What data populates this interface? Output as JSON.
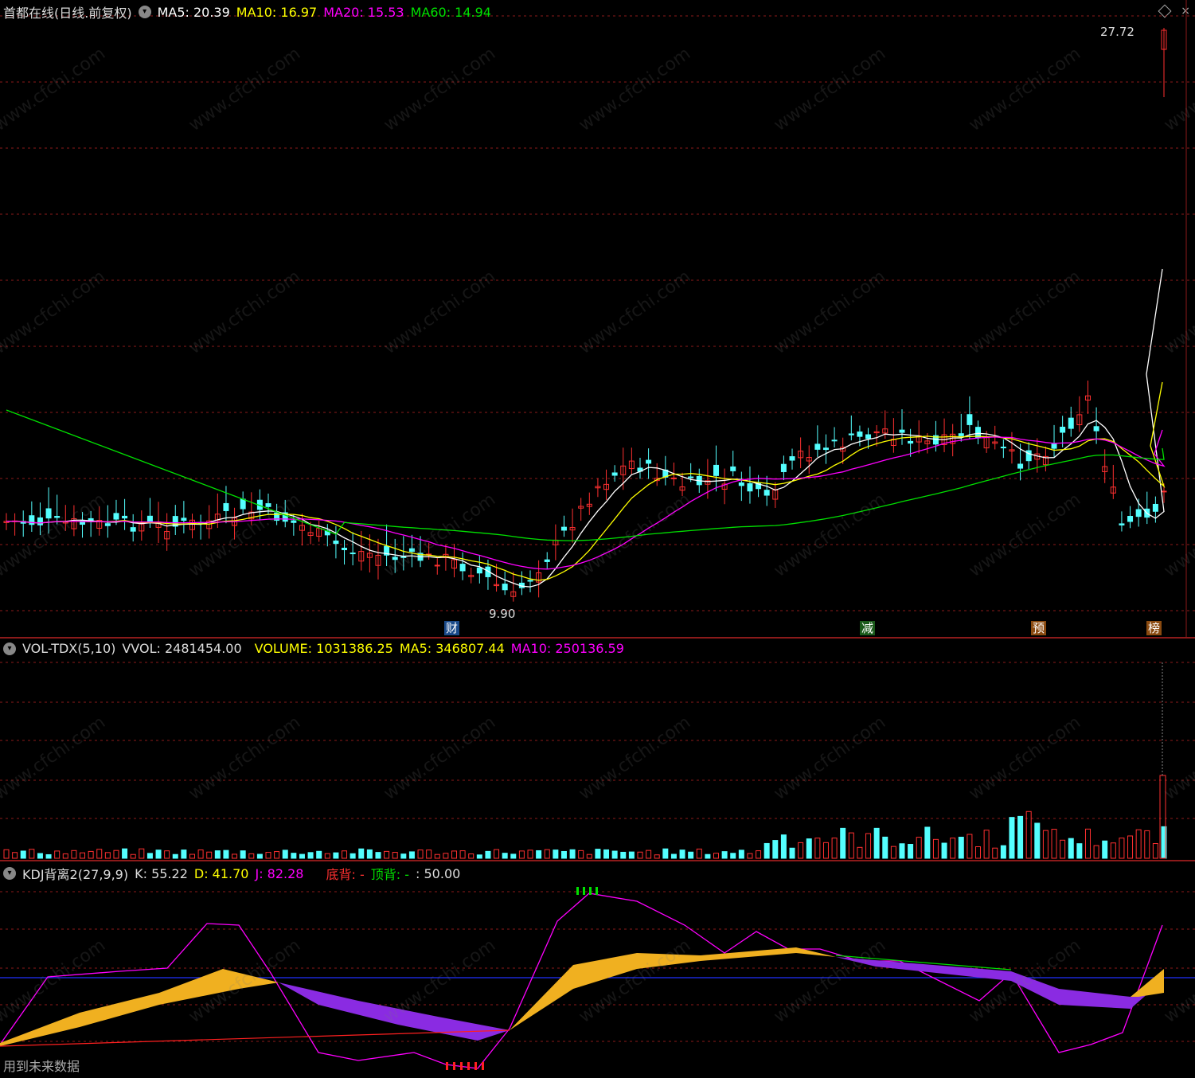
{
  "price_legend": {
    "title": "首都在线(日线.前复权)",
    "ma5": "MA5: 20.39",
    "ma10": "MA10: 16.97",
    "ma20": "MA20: 15.53",
    "ma60": "MA60: 14.94",
    "high_label": "27.72",
    "low_label": "9.90"
  },
  "event_tags": [
    "财",
    "减",
    "预",
    "榜"
  ],
  "volume_legend": {
    "title": "VOL-TDX(5,10)",
    "vvol": "VVOL: 2481454.00",
    "volume": "VOLUME: 1031386.25",
    "ma5": "MA5: 346807.44",
    "ma10": "MA10: 250136.59"
  },
  "kdj_legend": {
    "title": "KDJ背离2(27,9,9)",
    "k": "K: 55.22",
    "d": "D: 41.70",
    "j": "J: 82.28",
    "bottom_div": "底背: -",
    "top_div": "顶背: -",
    "level": ": 50.00"
  },
  "footer_note": "用到未来数据",
  "watermark_text": "www.cfchi.com",
  "colors": {
    "up": "#ff3030",
    "down": "#54ffff",
    "ma5": "#ffffff",
    "ma10": "#ffff00",
    "ma20": "#ff00ff",
    "ma60": "#00e000",
    "grid": "#8b1a1a",
    "kdj_fill_up": "#f0b020",
    "kdj_fill_down": "#8a2be2",
    "kdj_j": "#ff00ff",
    "kdj_mid": "#2030ff"
  }
}
